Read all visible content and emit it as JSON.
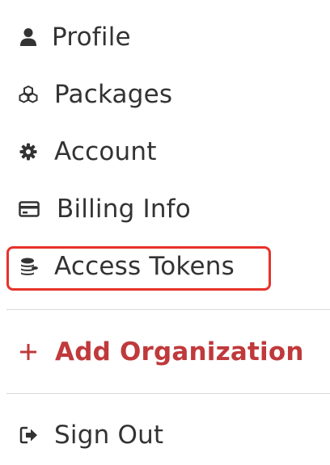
{
  "menu": {
    "items": [
      {
        "label": "Profile",
        "icon": "user-icon"
      },
      {
        "label": "Packages",
        "icon": "cubes-icon"
      },
      {
        "label": "Account",
        "icon": "gear-icon"
      },
      {
        "label": "Billing Info",
        "icon": "credit-card-icon"
      },
      {
        "label": "Access Tokens",
        "icon": "coins-icon",
        "highlighted": true
      }
    ],
    "add_organization": {
      "label": "Add Organization",
      "icon": "plus-icon",
      "color": "#c0393b"
    },
    "sign_out": {
      "label": "Sign Out",
      "icon": "sign-out-icon"
    }
  },
  "colors": {
    "text": "#333333",
    "highlight_border": "#e8322b",
    "accent": "#c0393b",
    "divider": "#d9d9d9"
  }
}
